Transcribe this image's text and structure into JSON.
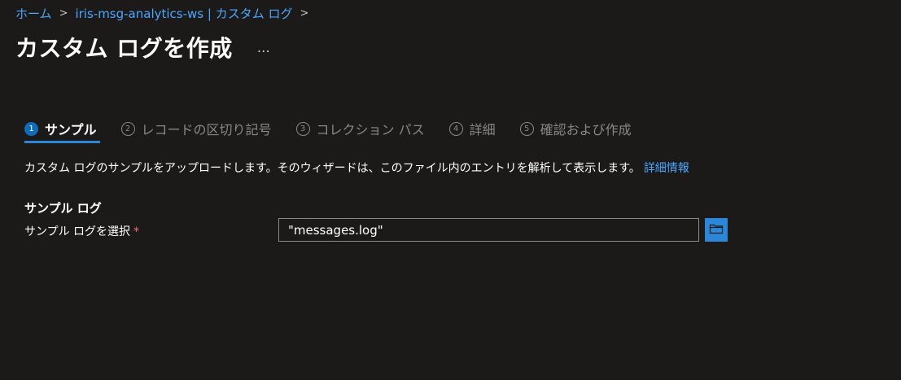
{
  "breadcrumb": {
    "items": [
      "ホーム",
      "iris-msg-analytics-ws | カスタム ログ"
    ]
  },
  "page": {
    "title": "カスタム ログを作成",
    "more_label": "…"
  },
  "wizard": {
    "steps": [
      {
        "number": "1",
        "label": "サンプル",
        "active": true
      },
      {
        "number": "2",
        "label": "レコードの区切り記号",
        "active": false
      },
      {
        "number": "3",
        "label": "コレクション パス",
        "active": false
      },
      {
        "number": "4",
        "label": "詳細",
        "active": false
      },
      {
        "number": "5",
        "label": "確認および作成",
        "active": false
      }
    ]
  },
  "content": {
    "description": "カスタム ログのサンプルをアップロードします。そのウィザードは、このファイル内のエントリを解析して表示します。",
    "learn_more": "詳細情報",
    "section_title": "サンプル ログ",
    "field_label": "サンプル ログを選択",
    "required_mark": "*",
    "file_value": "\"messages.log\"",
    "browse_icon": "folder-icon"
  },
  "colors": {
    "background": "#1b1a19",
    "link": "#4aa7ff",
    "accent": "#2b88d8",
    "required": "#f1707b"
  }
}
